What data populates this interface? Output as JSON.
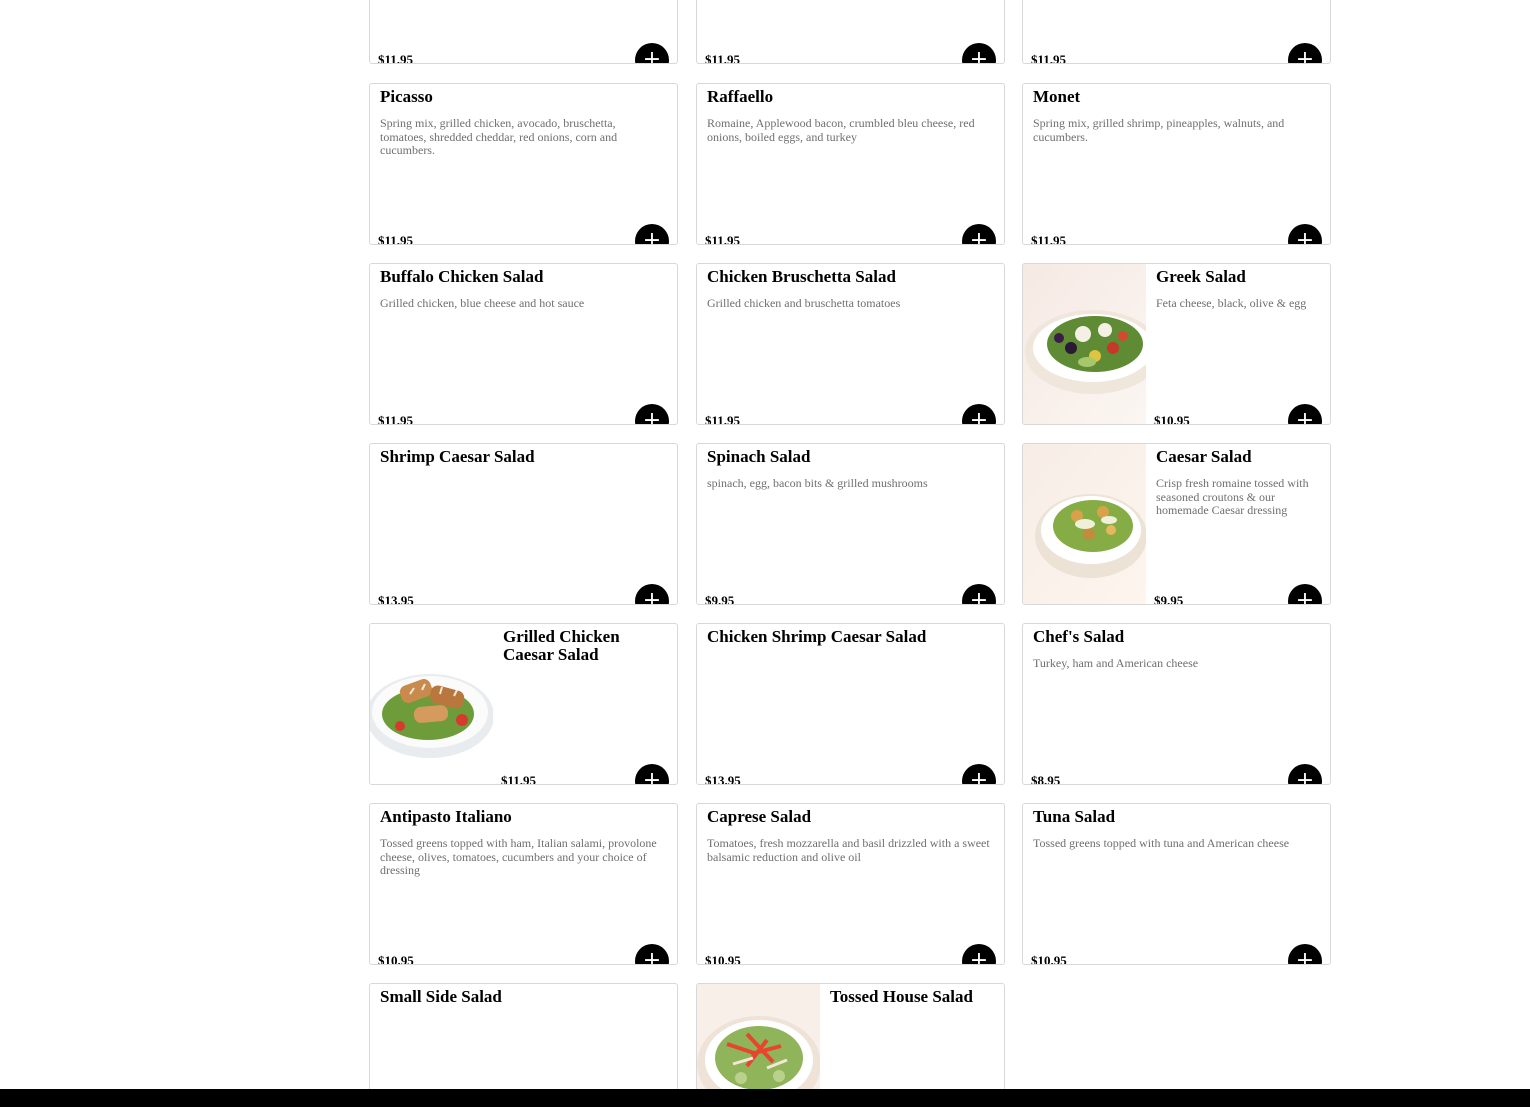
{
  "add_icon_glyph": "+",
  "cards": [
    {
      "title": "",
      "desc": "",
      "price": "$11.95"
    },
    {
      "title": "",
      "desc": "",
      "price": "$11.95"
    },
    {
      "title": "",
      "desc": "",
      "price": "$11.95"
    },
    {
      "title": "Picasso",
      "desc": "Spring mix, grilled chicken, avocado, bruschetta, tomatoes, shredded cheddar, red onions, corn and cucumbers.",
      "price": "$11.95"
    },
    {
      "title": "Raffaello",
      "desc": "Romaine, Applewood bacon, crumbled bleu cheese, red onions, boiled eggs, and turkey",
      "price": "$11.95"
    },
    {
      "title": "Monet",
      "desc": "Spring mix, grilled shrimp, pineapples, walnuts, and cucumbers.",
      "price": "$11.95"
    },
    {
      "title": "Buffalo Chicken Salad",
      "desc": "Grilled chicken, blue cheese and hot sauce",
      "price": "$11.95"
    },
    {
      "title": "Chicken Bruschetta Salad",
      "desc": "Grilled chicken and bruschetta tomatoes",
      "price": "$11.95"
    },
    {
      "title": "Greek Salad",
      "desc": "Feta cheese, black, olive & egg",
      "price": "$10.95"
    },
    {
      "title": "Shrimp Caesar Salad",
      "desc": "",
      "price": "$13.95"
    },
    {
      "title": "Spinach Salad",
      "desc": "spinach, egg, bacon bits & grilled mushrooms",
      "price": "$9.95"
    },
    {
      "title": "Caesar Salad",
      "desc": "Crisp fresh romaine tossed with seasoned croutons & our homemade Caesar dressing",
      "price": "$9.95"
    },
    {
      "title": "Grilled Chicken Caesar Salad",
      "desc": "",
      "price": "$11.95"
    },
    {
      "title": "Chicken Shrimp Caesar Salad",
      "desc": "",
      "price": "$13.95"
    },
    {
      "title": "Chef's Salad",
      "desc": "Turkey, ham and American cheese",
      "price": "$8.95"
    },
    {
      "title": "Antipasto Italiano",
      "desc": "Tossed greens topped with ham, Italian salami, provolone cheese, olives, tomatoes, cucumbers and your choice of dressing",
      "price": "$10.95"
    },
    {
      "title": "Caprese Salad",
      "desc": "Tomatoes, fresh mozzarella and basil drizzled with a sweet balsamic reduction and olive oil",
      "price": "$10.95"
    },
    {
      "title": "Tuna Salad",
      "desc": "Tossed greens topped with tuna and American cheese",
      "price": "$10.95"
    },
    {
      "title": "Small Side Salad",
      "desc": "",
      "price": ""
    },
    {
      "title": "Tossed House Salad",
      "desc": "",
      "price": ""
    }
  ]
}
